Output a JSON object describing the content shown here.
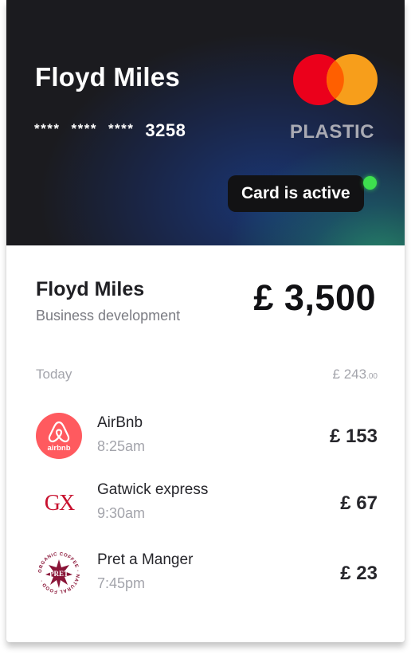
{
  "card": {
    "holder_name": "Floyd Miles",
    "number_mask": "****",
    "number_mask_2": "****",
    "number_mask_3": "****",
    "last_four": "3258",
    "type_label": "PLASTIC",
    "status_label": "Card is active",
    "brand_icon": "mastercard-icon",
    "colors": {
      "mc_red": "#eb001b",
      "mc_orange": "#f79e1b",
      "status_green": "#3ee04e"
    }
  },
  "employee": {
    "name": "Floyd Miles",
    "department": "Business development",
    "balance": "£ 3,500"
  },
  "transactions_section": {
    "day_label": "Today",
    "day_total_main": "£ 243",
    "day_total_pence": ".00"
  },
  "transactions": [
    {
      "merchant": "AirBnb",
      "time": "8:25am",
      "amount": "£ 153",
      "icon": "airbnb-icon",
      "icon_text": "airbnb",
      "icon_color": "#ff5a5f"
    },
    {
      "merchant": "Gatwick express",
      "time": "9:30am",
      "amount": "£ 67",
      "icon": "gatwick-express-icon",
      "icon_text": "GX",
      "icon_color": "#c8102e"
    },
    {
      "merchant": "Pret a Manger",
      "time": "7:45pm",
      "amount": "£ 23",
      "icon": "pret-a-manger-icon",
      "icon_text": "PRET",
      "icon_ring_text": "ORGANIC COFFEE · NATURAL FOOD ·",
      "icon_color": "#8a1538"
    }
  ]
}
